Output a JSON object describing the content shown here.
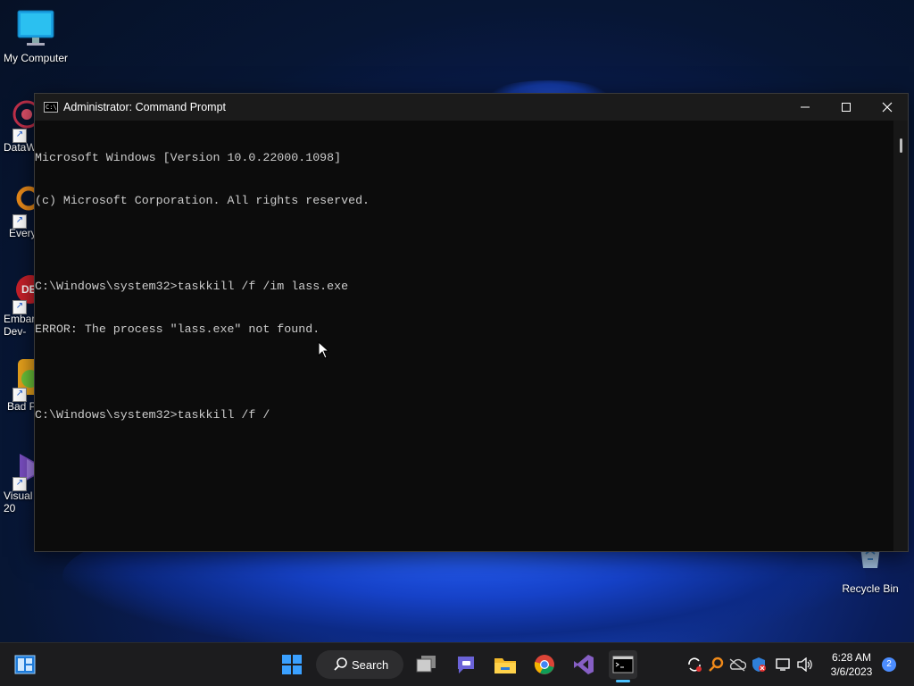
{
  "desktop": {
    "icons": [
      {
        "label": "My Computer",
        "icon": "monitor-icon"
      },
      {
        "label": "DataW",
        "icon": "datawedge-icon"
      },
      {
        "label": "Every",
        "icon": "everything-search-icon"
      },
      {
        "label": "Embar\nDev-",
        "icon": "embarcadero-icon"
      },
      {
        "label": "Bad P",
        "icon": "bad-piggies-icon"
      },
      {
        "label": "Visual\n20",
        "icon": "visual-studio-icon"
      }
    ],
    "recycle_bin": {
      "label": "Recycle Bin",
      "icon": "recycle-bin-icon"
    }
  },
  "window": {
    "title": "Administrator: Command Prompt",
    "console_lines": [
      "Microsoft Windows [Version 10.0.22000.1098]",
      "(c) Microsoft Corporation. All rights reserved.",
      "",
      "C:\\Windows\\system32>taskkill /f /im lass.exe",
      "ERROR: The process \"lass.exe\" not found.",
      "",
      "C:\\Windows\\system32>taskkill /f /"
    ]
  },
  "taskbar": {
    "search_label": "Search",
    "time": "6:28 AM",
    "date": "3/6/2023",
    "notification_count": "2",
    "apps": [
      "start-icon",
      "task-view-icon",
      "teams-chat-icon",
      "file-explorer-icon",
      "chrome-icon",
      "visual-studio-icon",
      "command-prompt-icon"
    ],
    "tray": [
      "sync-icon",
      "search-tool-icon",
      "onedrive-offline-icon",
      "security-icon",
      "network-icon",
      "volume-icon"
    ]
  },
  "colors": {
    "console_bg": "#0c0c0c",
    "console_text": "#cccccc",
    "taskbar_bg": "#1c1c1e",
    "accent": "#4cc2ff"
  }
}
